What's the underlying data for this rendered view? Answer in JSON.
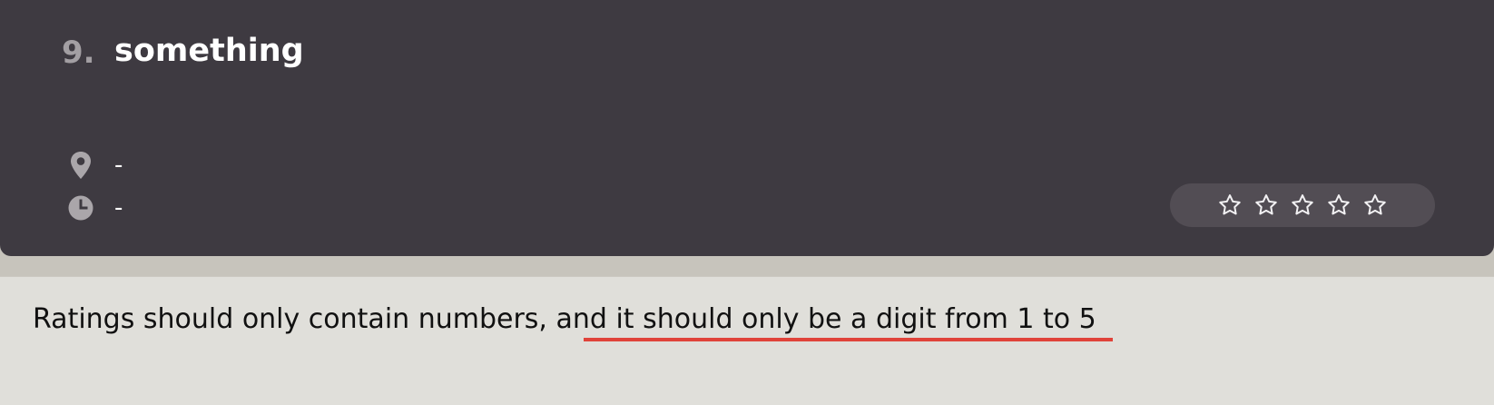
{
  "card": {
    "index": "9.",
    "title": "something",
    "location": "-",
    "time": "-",
    "rating": {
      "stars_total": 5,
      "stars_filled": 0,
      "icon": "star-outline-icon"
    }
  },
  "result": {
    "message": "Ratings should only contain numbers, and it should only be a digit from 1 to 5",
    "underline_color": "#e0433a"
  },
  "colors": {
    "card_bg": "#3e3a41",
    "rating_pill_bg": "#524d54",
    "result_bg": "#e0dfda",
    "accent_red": "#e0433a"
  }
}
